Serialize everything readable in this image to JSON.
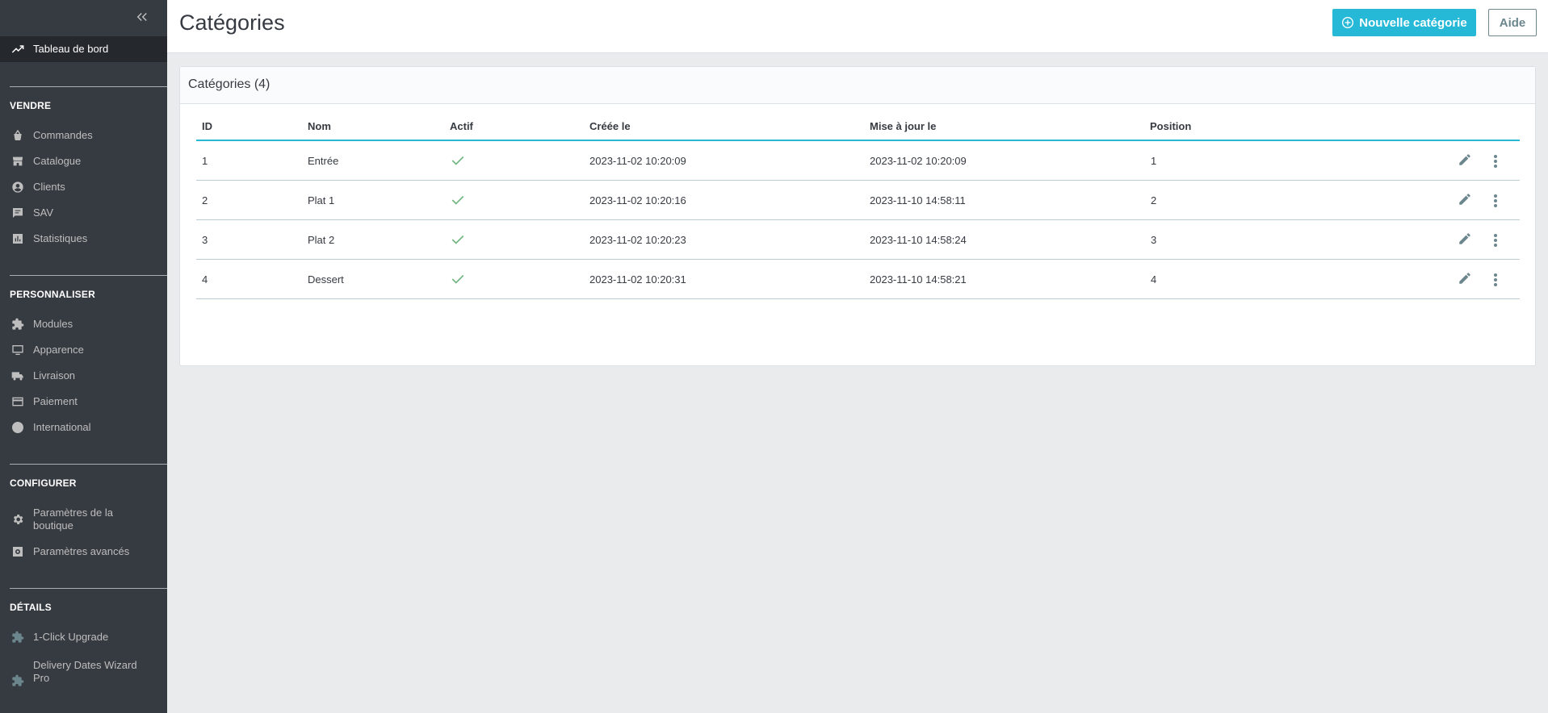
{
  "sidebar": {
    "dashboard": "Tableau de bord",
    "sections": [
      {
        "title": "VENDRE",
        "items": [
          "Commandes",
          "Catalogue",
          "Clients",
          "SAV",
          "Statistiques"
        ]
      },
      {
        "title": "PERSONNALISER",
        "items": [
          "Modules",
          "Apparence",
          "Livraison",
          "Paiement",
          "International"
        ]
      },
      {
        "title": "CONFIGURER",
        "items": [
          "Paramètres de la boutique",
          "Paramètres avancés"
        ]
      },
      {
        "title": "DÉTAILS",
        "items": [
          "1-Click Upgrade",
          "Delivery Dates Wizard Pro"
        ]
      }
    ]
  },
  "header": {
    "title": "Catégories",
    "new_button": "Nouvelle catégorie",
    "help_button": "Aide"
  },
  "card": {
    "title": "Catégories (4)"
  },
  "table": {
    "columns": [
      "ID",
      "Nom",
      "Actif",
      "Créée le",
      "Mise à jour le",
      "Position"
    ],
    "rows": [
      {
        "id": "1",
        "name": "Entrée",
        "active": true,
        "created": "2023-11-02 10:20:09",
        "updated": "2023-11-02 10:20:09",
        "position": "1"
      },
      {
        "id": "2",
        "name": "Plat 1",
        "active": true,
        "created": "2023-11-02 10:20:16",
        "updated": "2023-11-10 14:58:11",
        "position": "2"
      },
      {
        "id": "3",
        "name": "Plat 2",
        "active": true,
        "created": "2023-11-02 10:20:23",
        "updated": "2023-11-10 14:58:24",
        "position": "3"
      },
      {
        "id": "4",
        "name": "Dessert",
        "active": true,
        "created": "2023-11-02 10:20:31",
        "updated": "2023-11-10 14:58:21",
        "position": "4"
      }
    ]
  },
  "colors": {
    "accent": "#25b9d7",
    "sidebar_bg": "#363a41",
    "success": "#70b580"
  }
}
